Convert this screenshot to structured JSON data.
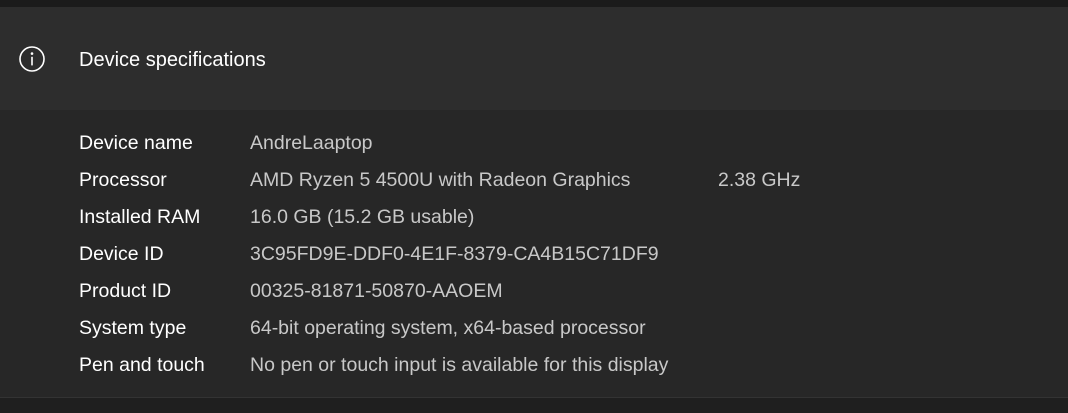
{
  "header": {
    "title": "Device specifications",
    "icon": "info-icon"
  },
  "specs": [
    {
      "label": "Device name",
      "value": "AndreLaaptop",
      "extra": ""
    },
    {
      "label": "Processor",
      "value": "AMD Ryzen 5 4500U with Radeon Graphics",
      "extra": "2.38 GHz"
    },
    {
      "label": "Installed RAM",
      "value": "16.0 GB (15.2 GB usable)",
      "extra": ""
    },
    {
      "label": "Device ID",
      "value": "3C95FD9E-DDF0-4E1F-8379-CA4B15C71DF9",
      "extra": ""
    },
    {
      "label": "Product ID",
      "value": "00325-81871-50870-AAOEM",
      "extra": ""
    },
    {
      "label": "System type",
      "value": "64-bit operating system, x64-based processor",
      "extra": ""
    },
    {
      "label": "Pen and touch",
      "value": "No pen or touch input is available for this display",
      "extra": ""
    }
  ]
}
